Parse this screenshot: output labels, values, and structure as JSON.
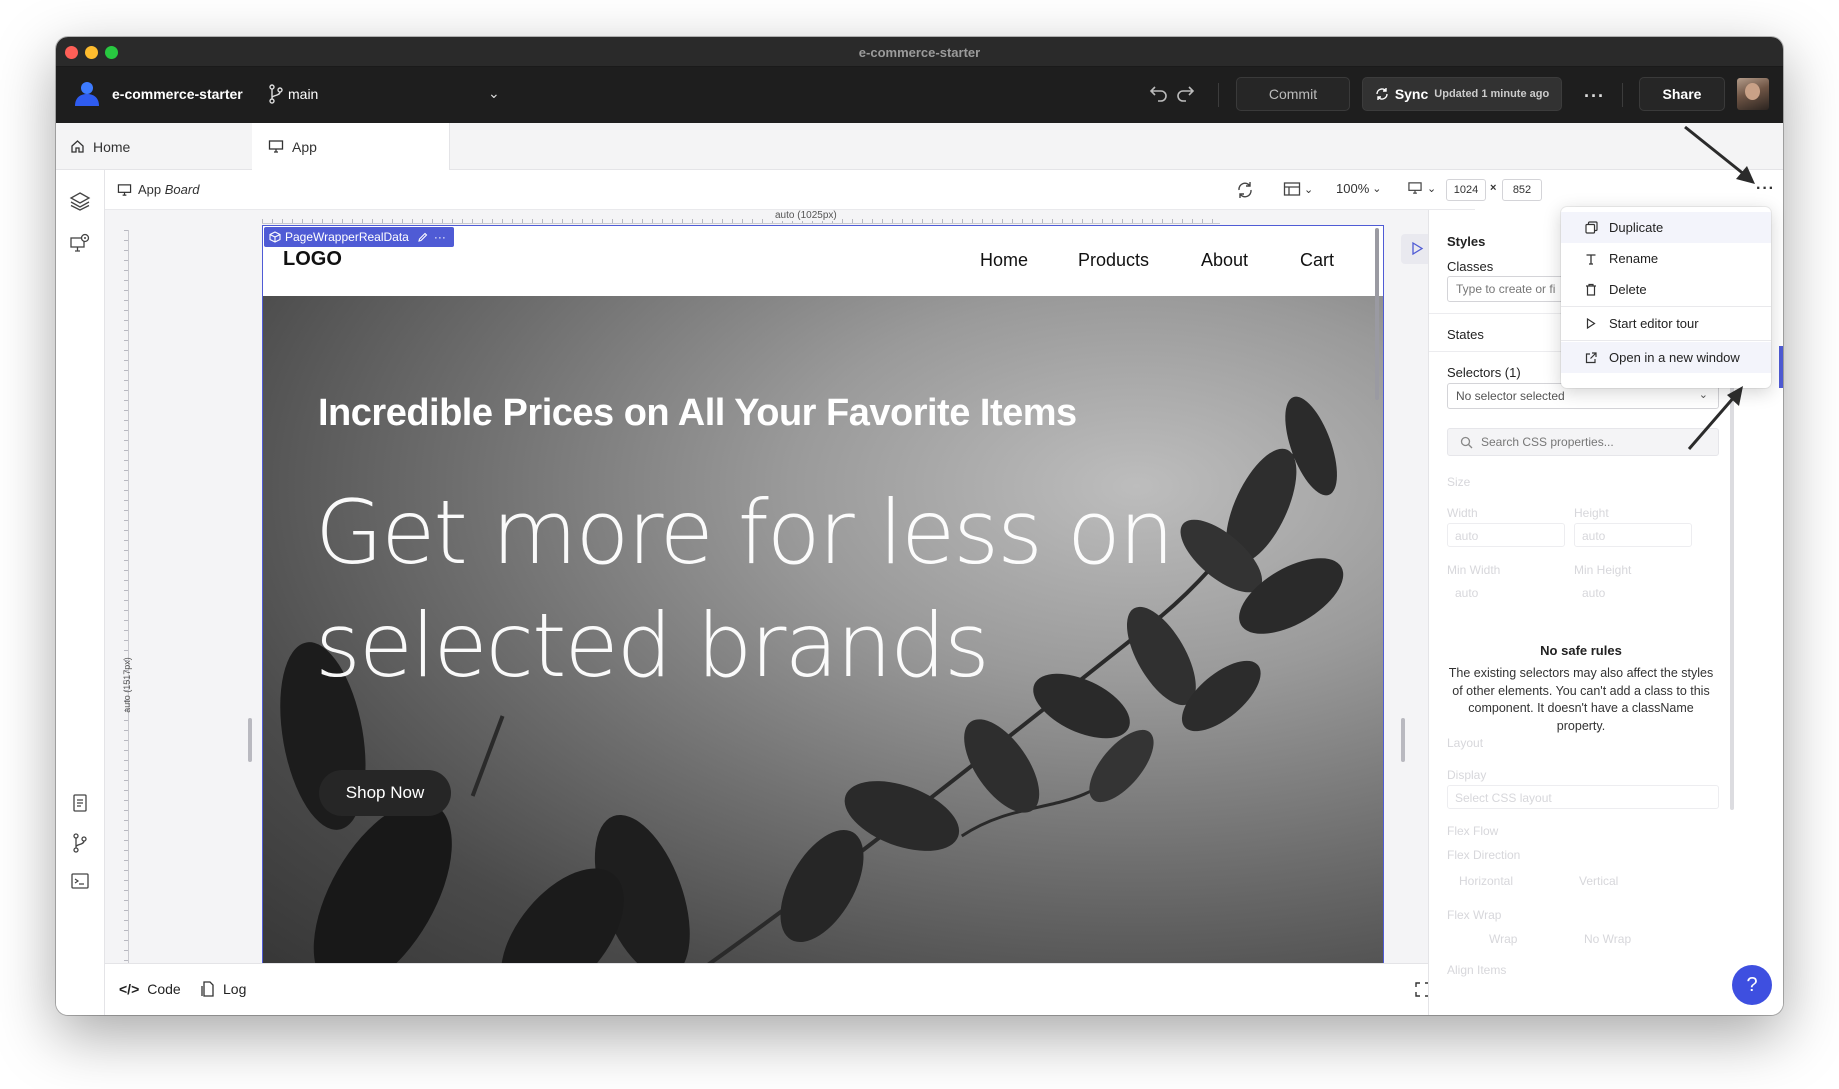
{
  "window": {
    "title": "e-commerce-starter"
  },
  "topbar": {
    "project_name": "e-commerce-starter",
    "branch": "main",
    "commit_label": "Commit",
    "sync_label": "Sync",
    "sync_status": "Updated 1 minute ago",
    "share_label": "Share"
  },
  "tabs": [
    {
      "label": "Home",
      "icon": "home-icon"
    },
    {
      "label": "App",
      "icon": "monitor-icon"
    }
  ],
  "boardbar": {
    "title_prefix": "App",
    "title_suffix": "Board",
    "zoom": "100%",
    "width": "1024",
    "times": "×",
    "height": "852"
  },
  "canvas": {
    "ruler_top_label": "auto (1025px)",
    "ruler_left_label": "auto (1517px)",
    "component_badge": "PageWrapperRealData"
  },
  "page": {
    "logo": "LOGO",
    "nav": [
      "Home",
      "Products",
      "About",
      "Cart"
    ],
    "hero_title": "Incredible Prices on All Your Favorite Items",
    "hero_subtitle": "Get more for less on selected brands",
    "hero_button": "Shop Now"
  },
  "bottombar": {
    "code_label": "Code",
    "code_glyph": "</>",
    "log_label": "Log"
  },
  "styles_panel": {
    "styles_label": "Styles",
    "classes_label": "Classes",
    "classes_placeholder": "Type to create or fi",
    "states_label": "States",
    "selectors_label": "Selectors (1)",
    "selector_value": "No selector selected",
    "search_placeholder": "Search CSS properties...",
    "empty_title": "No safe rules",
    "empty_text": "The existing selectors may also affect the styles of other elements. You can't add a class to this component. It doesn't have a className property.",
    "faded": {
      "size": "Size",
      "width": "Width",
      "height": "Height",
      "auto": "auto",
      "min_width": "Min Width",
      "min_height": "Min Height",
      "layout": "Layout",
      "display": "Display",
      "display_value": "Select CSS layout",
      "flex_flow": "Flex Flow",
      "flex_direction": "Flex Direction",
      "horizontal": "Horizontal",
      "vertical": "Vertical",
      "flex_wrap": "Flex Wrap",
      "wrap": "Wrap",
      "no_wrap": "No Wrap",
      "align_items": "Align Items"
    },
    "help_label": "?"
  },
  "menu": {
    "items": [
      {
        "label": "Duplicate",
        "icon": "duplicate-icon"
      },
      {
        "label": "Rename",
        "icon": "text-icon"
      },
      {
        "label": "Delete",
        "icon": "trash-icon"
      },
      {
        "label": "Start editor tour",
        "icon": "play-icon"
      },
      {
        "label": "Open in a new window",
        "icon": "external-link-icon"
      }
    ]
  },
  "colors": {
    "accent": "#4f5bd5",
    "topbar": "#1e1e1e",
    "help": "#3e4fe0"
  }
}
